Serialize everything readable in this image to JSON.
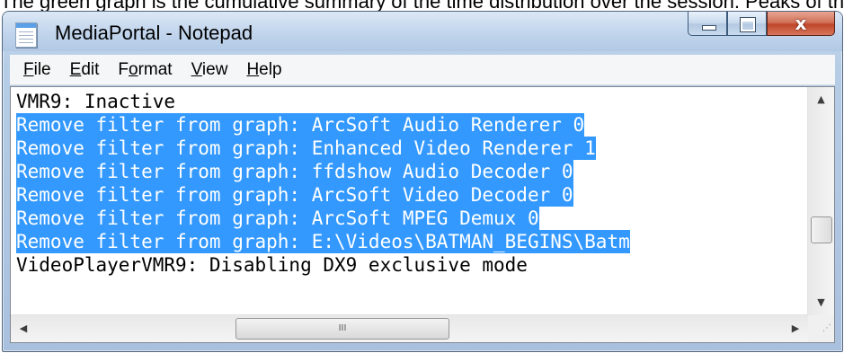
{
  "caption": "The green graph is the cumulative summary of the time distribution over the session. Peaks of the green graph",
  "window": {
    "title": "MediaPortal - Notepad",
    "app_icon": "notepad-icon",
    "controls": {
      "minimize": "minimize-icon",
      "maximize": "maximize-icon",
      "close_glyph": "x"
    }
  },
  "menu": [
    {
      "pre": "",
      "key": "F",
      "post": "ile"
    },
    {
      "pre": "",
      "key": "E",
      "post": "dit"
    },
    {
      "pre": "F",
      "key": "o",
      "post": "rmat"
    },
    {
      "pre": "",
      "key": "V",
      "post": "iew"
    },
    {
      "pre": "",
      "key": "H",
      "post": "elp"
    }
  ],
  "document": {
    "lines": [
      {
        "text": "VMR9: Inactive",
        "selected": false
      },
      {
        "text": "Remove filter from graph: ArcSoft Audio Renderer 0",
        "selected": true
      },
      {
        "text": "Remove filter from graph: Enhanced Video Renderer 1",
        "selected": true
      },
      {
        "text": "Remove filter from graph: ffdshow Audio Decoder 0",
        "selected": true
      },
      {
        "text": "Remove filter from graph: ArcSoft Video Decoder 0",
        "selected": true
      },
      {
        "text": "Remove filter from graph: ArcSoft MPEG Demux 0",
        "selected": true
      },
      {
        "text": "Remove filter from graph: E:\\Videos\\BATMAN_BEGINS\\Batm",
        "selected": true
      },
      {
        "text": "VideoPlayerVMR9: Disabling DX9 exclusive mode",
        "selected": false
      }
    ]
  },
  "scrollbars": {
    "vertical": {
      "up": "▲",
      "down": "▼",
      "position": 0.62
    },
    "horizontal": {
      "left": "◀",
      "right": "▶",
      "grip": "III",
      "position": 0.3
    }
  },
  "colors": {
    "selection_bg": "#3399ff",
    "selection_text": "#ffffff",
    "close_button": "#c0462a"
  }
}
